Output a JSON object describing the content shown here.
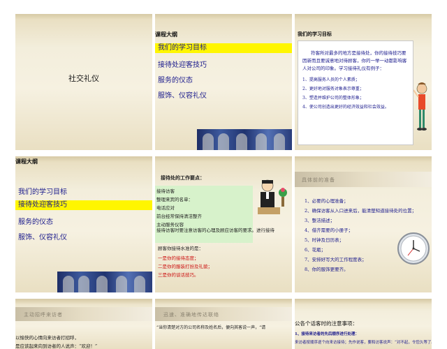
{
  "slides": {
    "s1": {
      "title": "社交礼仪"
    },
    "s2": {
      "heading": "课程大纲",
      "items": [
        "我们的学习目标",
        "接待处迎客技巧",
        "服务的仪态",
        "服饰、仪容礼仪"
      ]
    },
    "s3": {
      "heading": "我们的学习目标",
      "paragraph": "符客所对最多的地方是接待处，你的接待技巧要因新而且要诚意地对待顾客，你的一举一动都影响客人对公司的印象。学习接待礼仪有例子：",
      "list": [
        "1、提高服务人员的个人素质；",
        "2、更好地对服务对象表示尊重；",
        "3、塑造并维护公司的整体形象；",
        "4、使公司创造出更好的经济效益和社会效益。"
      ]
    },
    "s4": {
      "heading": "课程大纲",
      "items": [
        "我们的学习目标",
        "接待处迎客技巧",
        "服务的仪态",
        "服饰、仪容礼仪"
      ]
    },
    "s5": {
      "title": "接待处的工作要点：",
      "lines": [
        "接待访客",
        "整理来宾的名单：",
        "电话应对",
        "前台经常保持清洁整齐",
        "主动服务仪容"
      ],
      "long_line": "接待访客时要注意访客的心理及顾应访客的要求。进行接待",
      "question": "顾客你接待水准的是：",
      "checks": [
        "一是你的接待态度；",
        "二是你的服装打扮及礼貌；",
        "三是你的谈话技巧。"
      ]
    },
    "s6": {
      "title": "具体前的准备",
      "items": [
        "1、必要的心理准备；",
        "2、确保访客从入口进来后，能清楚知道接待处的位置；",
        "3、整洁描述；",
        "4、借齐需要的小册子；",
        "5、时钟及日历表；",
        "6、花瓶；",
        "7、安排好写大的工作程度表；",
        "8、你的服饰更要齐。"
      ]
    },
    "s7": {
      "banner": "主动招呼来访者",
      "lines": [
        "以愉快的心情向来访者打招呼，",
        "是应该起来向到访者的人说声：“欢迎！”"
      ]
    },
    "s8": {
      "banner": "迅速、准确地传达联络",
      "line": "“当你清楚对方的公司名称及姓名后，便向其客说一声，“请"
    },
    "s9": {
      "title": "公各个话客时的注意事项：",
      "sub": "1、接待来访者的先后顺序进行处理：",
      "line": "来访者按顺序逐个向来访接待；先作说客，要和访客说声：“对不起，令您久等了。”"
    }
  },
  "colors": {
    "highlight": "#fff600",
    "text_blue": "#1a1a8c",
    "green_box": "#d7f2cb",
    "check_red": "#cc1111"
  }
}
